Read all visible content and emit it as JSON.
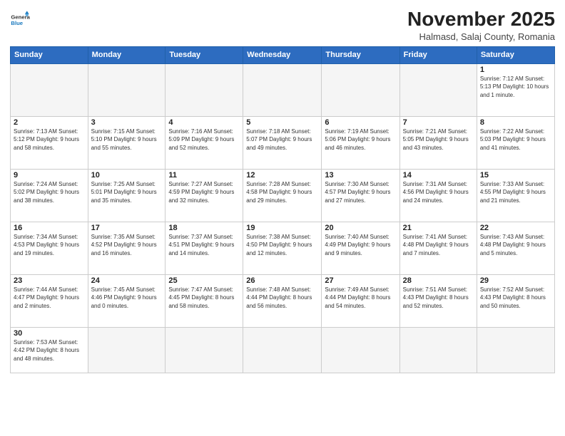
{
  "header": {
    "logo_general": "General",
    "logo_blue": "Blue",
    "month": "November 2025",
    "location": "Halmasd, Salaj County, Romania"
  },
  "days_of_week": [
    "Sunday",
    "Monday",
    "Tuesday",
    "Wednesday",
    "Thursday",
    "Friday",
    "Saturday"
  ],
  "weeks": [
    [
      {
        "day": "",
        "info": ""
      },
      {
        "day": "",
        "info": ""
      },
      {
        "day": "",
        "info": ""
      },
      {
        "day": "",
        "info": ""
      },
      {
        "day": "",
        "info": ""
      },
      {
        "day": "",
        "info": ""
      },
      {
        "day": "1",
        "info": "Sunrise: 7:12 AM\nSunset: 5:13 PM\nDaylight: 10 hours and 1 minute."
      }
    ],
    [
      {
        "day": "2",
        "info": "Sunrise: 7:13 AM\nSunset: 5:12 PM\nDaylight: 9 hours and 58 minutes."
      },
      {
        "day": "3",
        "info": "Sunrise: 7:15 AM\nSunset: 5:10 PM\nDaylight: 9 hours and 55 minutes."
      },
      {
        "day": "4",
        "info": "Sunrise: 7:16 AM\nSunset: 5:09 PM\nDaylight: 9 hours and 52 minutes."
      },
      {
        "day": "5",
        "info": "Sunrise: 7:18 AM\nSunset: 5:07 PM\nDaylight: 9 hours and 49 minutes."
      },
      {
        "day": "6",
        "info": "Sunrise: 7:19 AM\nSunset: 5:06 PM\nDaylight: 9 hours and 46 minutes."
      },
      {
        "day": "7",
        "info": "Sunrise: 7:21 AM\nSunset: 5:05 PM\nDaylight: 9 hours and 43 minutes."
      },
      {
        "day": "8",
        "info": "Sunrise: 7:22 AM\nSunset: 5:03 PM\nDaylight: 9 hours and 41 minutes."
      }
    ],
    [
      {
        "day": "9",
        "info": "Sunrise: 7:24 AM\nSunset: 5:02 PM\nDaylight: 9 hours and 38 minutes."
      },
      {
        "day": "10",
        "info": "Sunrise: 7:25 AM\nSunset: 5:01 PM\nDaylight: 9 hours and 35 minutes."
      },
      {
        "day": "11",
        "info": "Sunrise: 7:27 AM\nSunset: 4:59 PM\nDaylight: 9 hours and 32 minutes."
      },
      {
        "day": "12",
        "info": "Sunrise: 7:28 AM\nSunset: 4:58 PM\nDaylight: 9 hours and 29 minutes."
      },
      {
        "day": "13",
        "info": "Sunrise: 7:30 AM\nSunset: 4:57 PM\nDaylight: 9 hours and 27 minutes."
      },
      {
        "day": "14",
        "info": "Sunrise: 7:31 AM\nSunset: 4:56 PM\nDaylight: 9 hours and 24 minutes."
      },
      {
        "day": "15",
        "info": "Sunrise: 7:33 AM\nSunset: 4:55 PM\nDaylight: 9 hours and 21 minutes."
      }
    ],
    [
      {
        "day": "16",
        "info": "Sunrise: 7:34 AM\nSunset: 4:53 PM\nDaylight: 9 hours and 19 minutes."
      },
      {
        "day": "17",
        "info": "Sunrise: 7:35 AM\nSunset: 4:52 PM\nDaylight: 9 hours and 16 minutes."
      },
      {
        "day": "18",
        "info": "Sunrise: 7:37 AM\nSunset: 4:51 PM\nDaylight: 9 hours and 14 minutes."
      },
      {
        "day": "19",
        "info": "Sunrise: 7:38 AM\nSunset: 4:50 PM\nDaylight: 9 hours and 12 minutes."
      },
      {
        "day": "20",
        "info": "Sunrise: 7:40 AM\nSunset: 4:49 PM\nDaylight: 9 hours and 9 minutes."
      },
      {
        "day": "21",
        "info": "Sunrise: 7:41 AM\nSunset: 4:48 PM\nDaylight: 9 hours and 7 minutes."
      },
      {
        "day": "22",
        "info": "Sunrise: 7:43 AM\nSunset: 4:48 PM\nDaylight: 9 hours and 5 minutes."
      }
    ],
    [
      {
        "day": "23",
        "info": "Sunrise: 7:44 AM\nSunset: 4:47 PM\nDaylight: 9 hours and 2 minutes."
      },
      {
        "day": "24",
        "info": "Sunrise: 7:45 AM\nSunset: 4:46 PM\nDaylight: 9 hours and 0 minutes."
      },
      {
        "day": "25",
        "info": "Sunrise: 7:47 AM\nSunset: 4:45 PM\nDaylight: 8 hours and 58 minutes."
      },
      {
        "day": "26",
        "info": "Sunrise: 7:48 AM\nSunset: 4:44 PM\nDaylight: 8 hours and 56 minutes."
      },
      {
        "day": "27",
        "info": "Sunrise: 7:49 AM\nSunset: 4:44 PM\nDaylight: 8 hours and 54 minutes."
      },
      {
        "day": "28",
        "info": "Sunrise: 7:51 AM\nSunset: 4:43 PM\nDaylight: 8 hours and 52 minutes."
      },
      {
        "day": "29",
        "info": "Sunrise: 7:52 AM\nSunset: 4:43 PM\nDaylight: 8 hours and 50 minutes."
      }
    ],
    [
      {
        "day": "30",
        "info": "Sunrise: 7:53 AM\nSunset: 4:42 PM\nDaylight: 8 hours and 48 minutes."
      },
      {
        "day": "",
        "info": ""
      },
      {
        "day": "",
        "info": ""
      },
      {
        "day": "",
        "info": ""
      },
      {
        "day": "",
        "info": ""
      },
      {
        "day": "",
        "info": ""
      },
      {
        "day": "",
        "info": ""
      }
    ]
  ]
}
